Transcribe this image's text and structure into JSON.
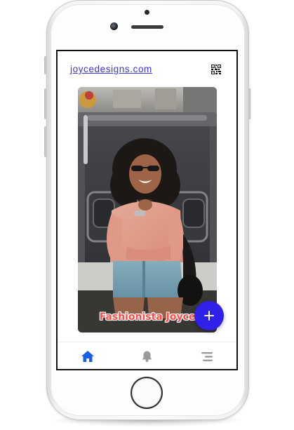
{
  "header": {
    "site_link": "joycedesigns.com",
    "qr_icon": "qr-code-icon"
  },
  "card": {
    "caption": "Fashionista Joyce",
    "caption_color": "#ff4b4b"
  },
  "fab": {
    "icon": "plus-icon",
    "color": "#2f21e8"
  },
  "bottom_nav": {
    "items": [
      {
        "icon": "home-icon",
        "active": true,
        "color": "#1a5ee6"
      },
      {
        "icon": "bell-icon",
        "active": false,
        "color": "#9a9a9a"
      },
      {
        "icon": "menu-icon",
        "active": false,
        "color": "#9a9a9a"
      }
    ]
  }
}
